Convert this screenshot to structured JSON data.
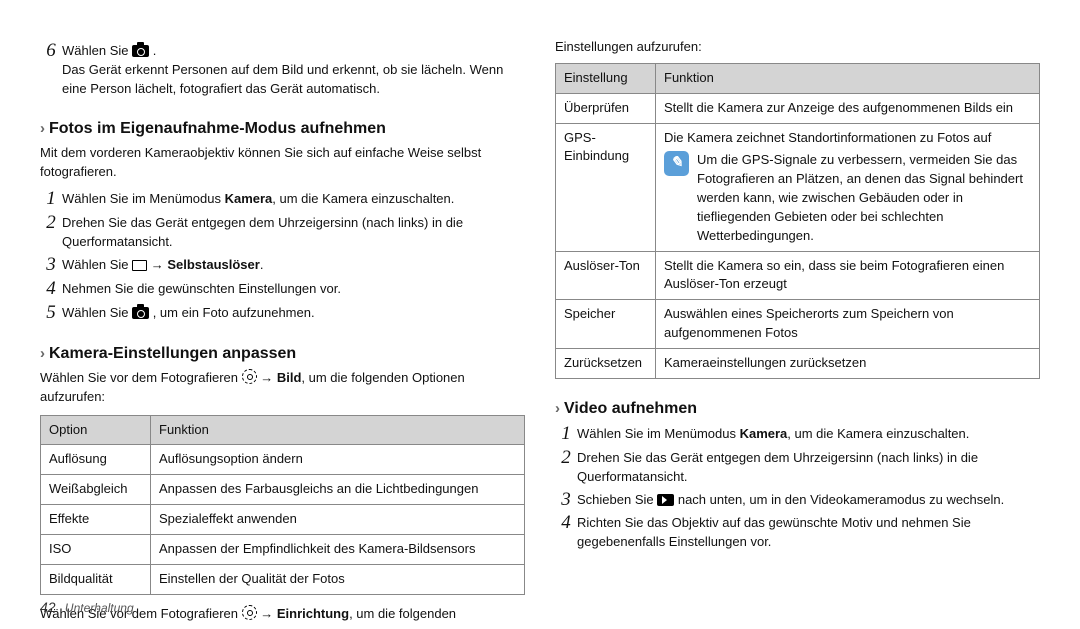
{
  "left": {
    "step6": {
      "num": "6",
      "line": "Wählen Sie",
      "desc": "Das Gerät erkennt Personen auf dem Bild und erkennt, ob sie lächeln. Wenn eine Person lächelt, fotografiert das Gerät automatisch."
    },
    "sec1": {
      "title": "Fotos im Eigenaufnahme-Modus aufnehmen",
      "intro": "Mit dem vorderen Kameraobjektiv können Sie sich auf einfache Weise selbst fotografieren.",
      "steps": {
        "s1a": "Wählen Sie im Menümodus ",
        "s1b": "Kamera",
        "s1c": ", um die Kamera einzuschalten.",
        "s2": "Drehen Sie das Gerät entgegen dem Uhrzeigersinn (nach links) in die Querformatansicht.",
        "s3a": "Wählen Sie ",
        "s3b": " → ",
        "s3c": "Selbstauslöser",
        "s4": "Nehmen Sie die gewünschten Einstellungen vor.",
        "s5a": "Wählen Sie ",
        "s5b": " , um ein Foto aufzunehmen."
      }
    },
    "sec2": {
      "title": "Kamera-Einstellungen anpassen",
      "intro_a": "Wählen Sie vor dem Fotografieren ",
      "intro_b": " → ",
      "intro_c": "Bild",
      "intro_d": ", um die folgenden Optionen aufzurufen:"
    },
    "table1": {
      "h1": "Option",
      "h2": "Funktion",
      "rows": [
        [
          "Auflösung",
          "Auflösungsoption ändern"
        ],
        [
          "Weißabgleich",
          "Anpassen des Farbausgleichs an die Lichtbedingungen"
        ],
        [
          "Effekte",
          "Spezialeffekt anwenden"
        ],
        [
          "ISO",
          "Anpassen der Empfindlichkeit des Kamera-Bildsensors"
        ],
        [
          "Bildqualität",
          "Einstellen der Qualität der Fotos"
        ]
      ]
    },
    "afterTable_a": "Wählen Sie vor dem Fotografieren ",
    "afterTable_b": " → ",
    "afterTable_c": "Einrichtung",
    "afterTable_d": ", um die folgenden"
  },
  "right": {
    "top": "Einstellungen aufzurufen:",
    "table2": {
      "h1": "Einstellung",
      "h2": "Funktion",
      "r1": [
        "Überprüfen",
        "Stellt die Kamera zur Anzeige des aufgenommenen Bilds ein"
      ],
      "r2_label": "GPS-Einbindung",
      "r2_body1": "Die Kamera zeichnet Standortinformationen zu Fotos auf",
      "r2_body2": "Um die GPS-Signale zu verbessern, vermeiden Sie das Fotografieren an Plätzen, an denen das Signal behindert werden kann, wie zwischen Gebäuden oder in tiefliegenden Gebieten oder bei schlechten Wetterbedingungen.",
      "r3": [
        "Auslöser-Ton",
        "Stellt die Kamera so ein, dass sie beim Fotografieren einen Auslöser-Ton erzeugt"
      ],
      "r4": [
        "Speicher",
        "Auswählen eines Speicherorts zum Speichern von aufgenommenen Fotos"
      ],
      "r5": [
        "Zurücksetzen",
        "Kameraeinstellungen zurücksetzen"
      ]
    },
    "sec3": {
      "title": "Video aufnehmen",
      "s1a": "Wählen Sie im Menümodus ",
      "s1b": "Kamera",
      "s1c": ", um die Kamera einzuschalten.",
      "s2": "Drehen Sie das Gerät entgegen dem Uhrzeigersinn (nach links) in die Querformatansicht.",
      "s3a": "Schieben Sie ",
      "s3b": " nach unten, um in den Videokameramodus zu wechseln.",
      "s4": "Richten Sie das Objektiv auf das gewünschte Motiv und nehmen Sie gegebenenfalls Einstellungen vor."
    }
  },
  "footer": {
    "page": "42",
    "section": "Unterhaltung"
  }
}
